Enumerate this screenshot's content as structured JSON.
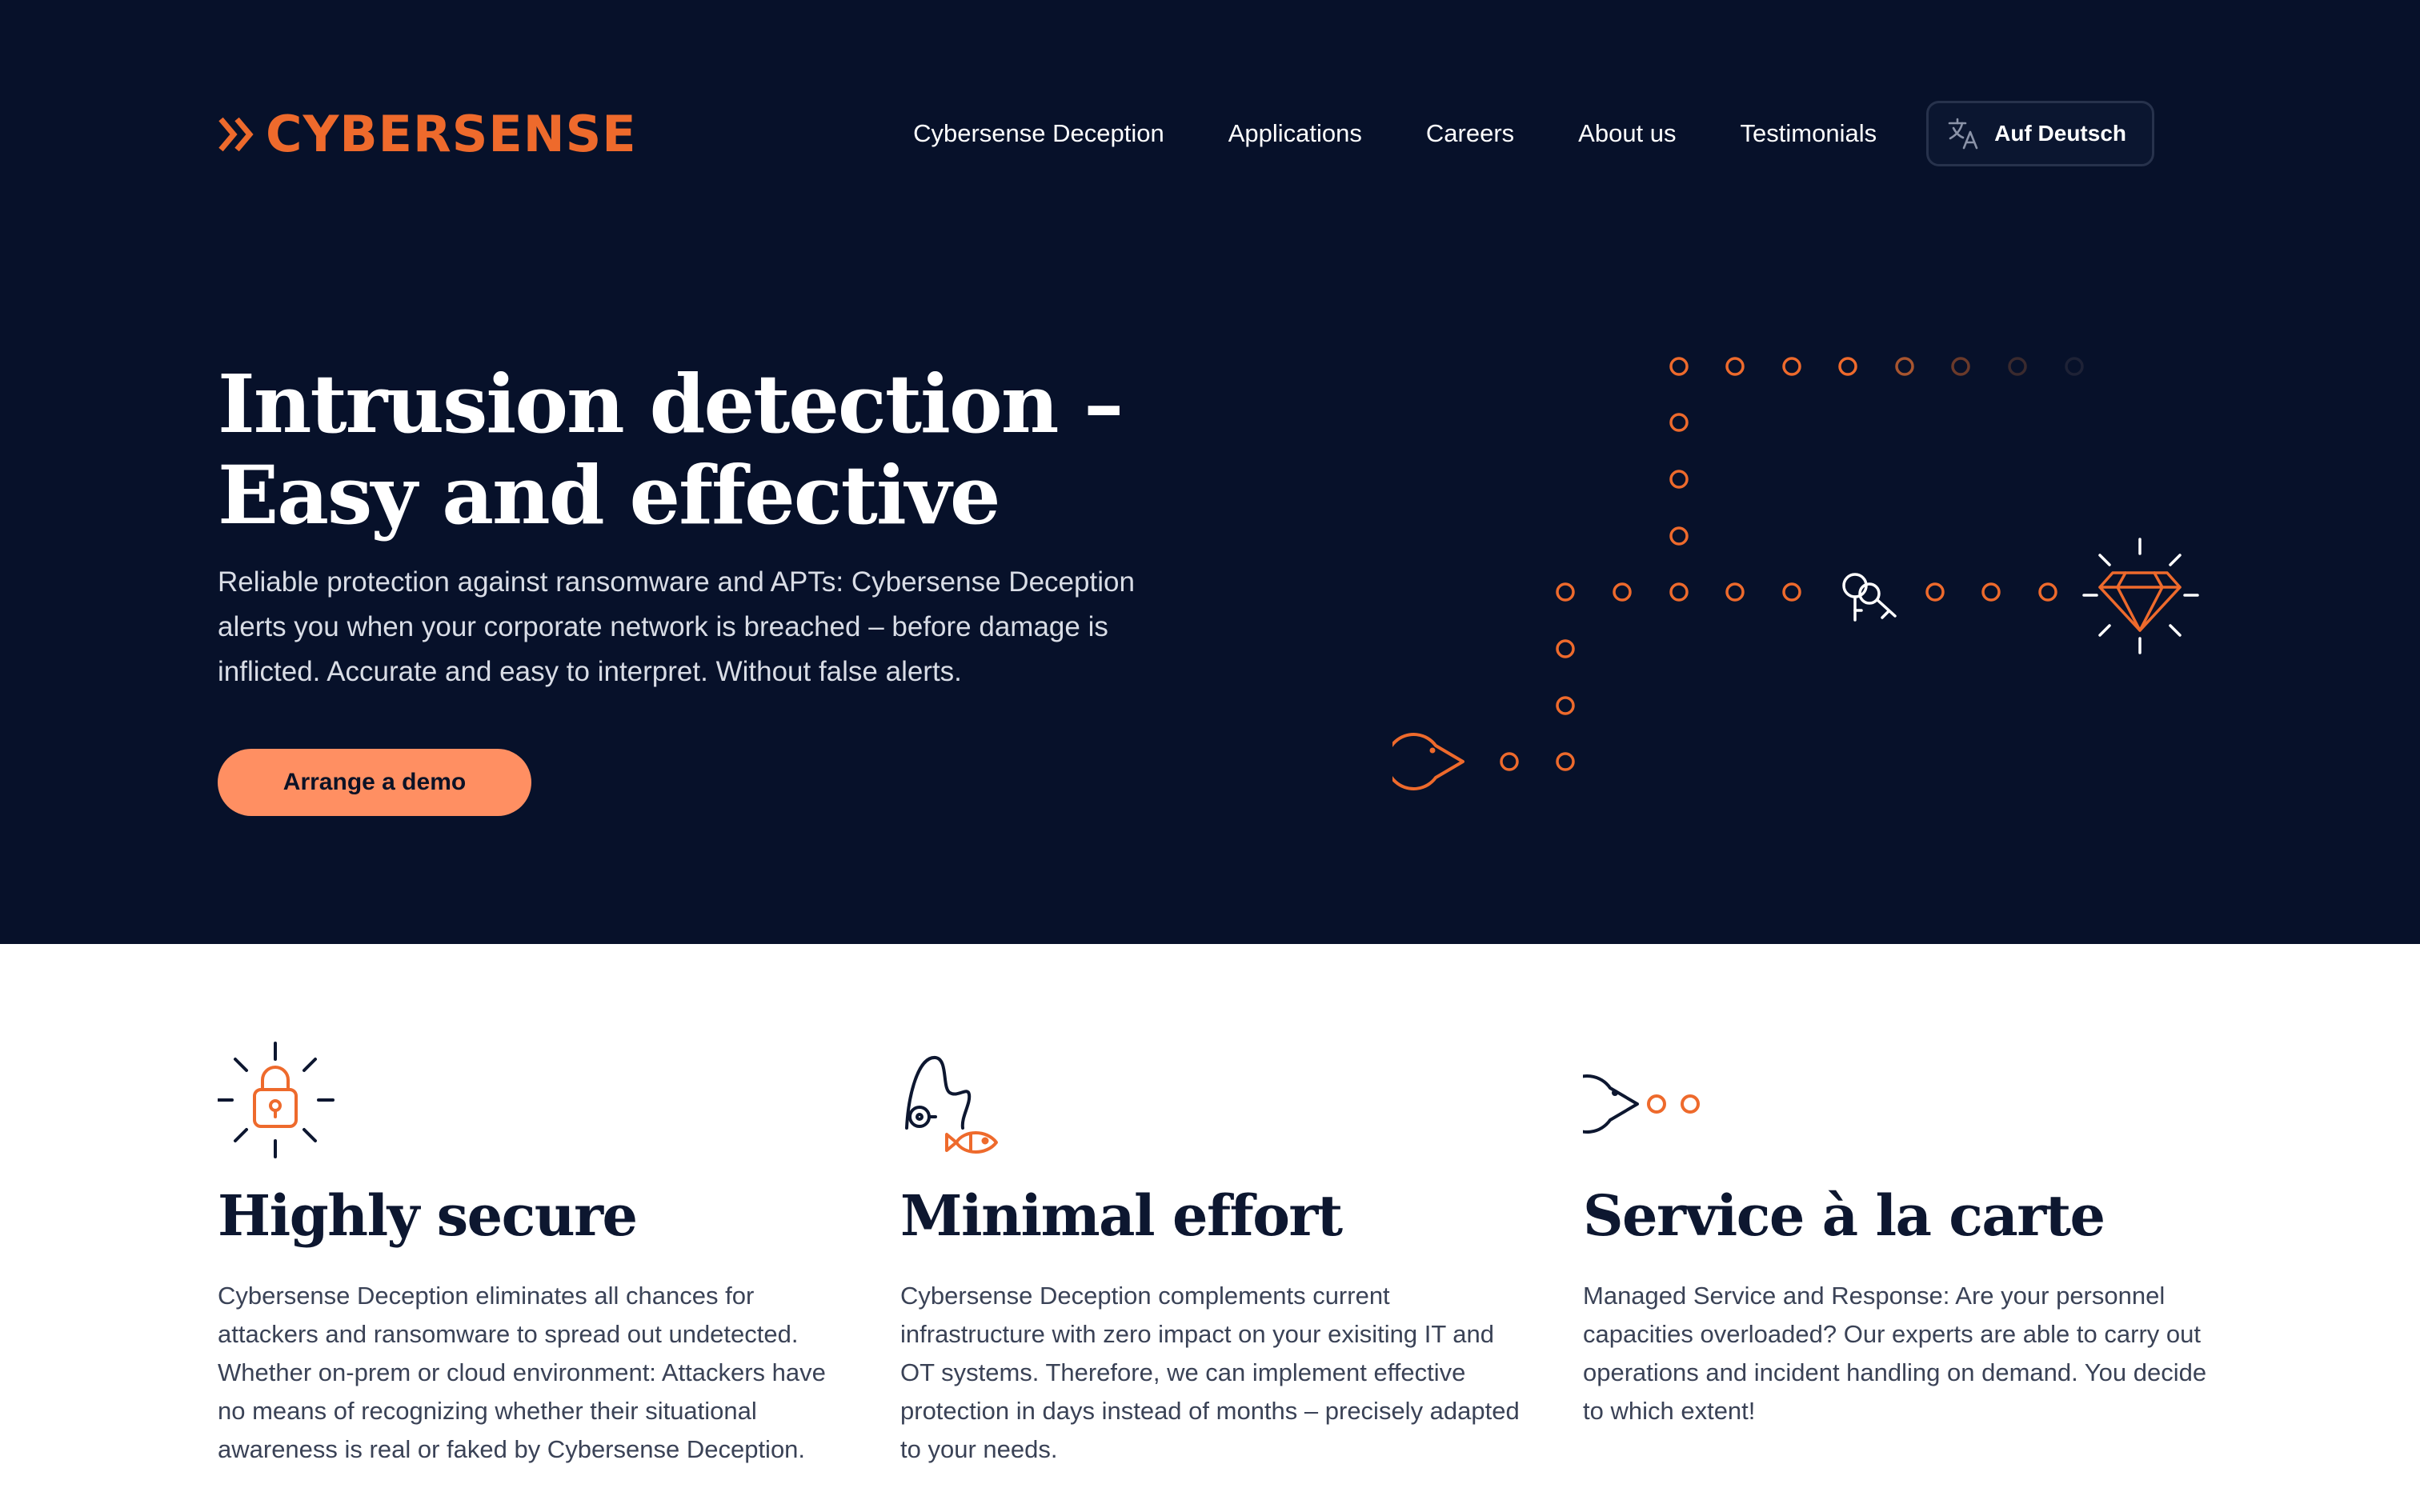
{
  "brand": {
    "name": "CYBERSENSE",
    "color": "#ee6a2c"
  },
  "nav": {
    "items": [
      {
        "label": "Cybersense Deception"
      },
      {
        "label": "Applications"
      },
      {
        "label": "Careers"
      },
      {
        "label": "About us"
      },
      {
        "label": "Testimonials"
      }
    ],
    "language_button": {
      "label": "Auf Deutsch",
      "icon": "translate-icon"
    }
  },
  "hero": {
    "title": "Intrusion detection – Easy and effective",
    "description": "Reliable protection against ransomware and APTs: Cybersense Deception alerts you when your corporate network is breached – before damage is inflicted. Accurate and easy to interpret. Without false alerts.",
    "cta_label": "Arrange a demo",
    "graphic_icons": [
      "pacman-icon",
      "key-icon",
      "diamond-icon"
    ]
  },
  "features": [
    {
      "icon": "padlock-icon",
      "title": "Highly secure",
      "text": "Cybersense Deception eliminates all chances for attackers and ransomware to spread out undetected. Whether on-prem or cloud environment: Attackers have no means of recognizing whether their situational awareness is real or faked by Cybersense Deception."
    },
    {
      "icon": "fishing-rod-icon",
      "title": "Minimal effort",
      "text": "Cybersense Deception complements current infrastructure with zero impact on your exisiting IT and OT systems. Therefore, we can implement effective protection in days instead of months – precisely adapted to your needs."
    },
    {
      "icon": "pacman-icon",
      "title": "Service à la carte",
      "text": "Managed Service and Response: Are your personnel capacities overloaded? Our experts are able to carry out operations and incident handling on demand. You decide to which extent!"
    }
  ],
  "colors": {
    "hero_background": "#07112a",
    "accent": "#ee6a2c",
    "cta_background": "#ff8f62",
    "heading": "#0d1730",
    "body_text": "#3a4256"
  }
}
